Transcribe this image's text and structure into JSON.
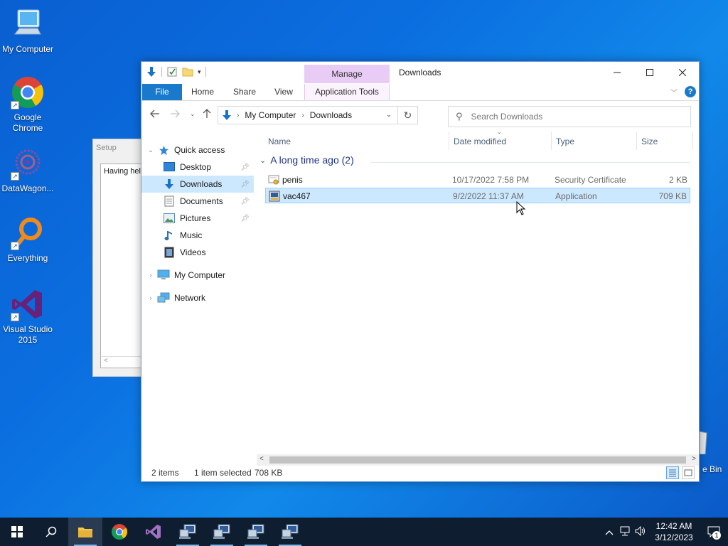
{
  "desktop": {
    "icons": [
      {
        "label": "My Computer"
      },
      {
        "label": "Google Chrome"
      },
      {
        "label": "DataWagon..."
      },
      {
        "label": "Everything"
      },
      {
        "label": "Visual Studio 2015"
      }
    ],
    "recycle_bin_partial": "e Bin"
  },
  "setup_window": {
    "title": "Setup",
    "text": "Having help"
  },
  "explorer": {
    "title": "Downloads",
    "context_tab": "Manage",
    "ribbon_tabs": {
      "file": "File",
      "home": "Home",
      "share": "Share",
      "view": "View",
      "app_tools": "Application Tools"
    },
    "address": {
      "crumbs": [
        "My Computer",
        "Downloads"
      ]
    },
    "search": {
      "placeholder": "Search Downloads"
    },
    "nav": {
      "quick_access": "Quick access",
      "items": [
        {
          "label": "Desktop",
          "pinned": true
        },
        {
          "label": "Downloads",
          "pinned": true,
          "selected": true
        },
        {
          "label": "Documents",
          "pinned": true
        },
        {
          "label": "Pictures",
          "pinned": true
        },
        {
          "label": "Music",
          "pinned": false
        },
        {
          "label": "Videos",
          "pinned": false
        }
      ],
      "my_computer": "My Computer",
      "network": "Network"
    },
    "columns": {
      "name": "Name",
      "date": "Date modified",
      "type": "Type",
      "size": "Size"
    },
    "group": {
      "label": "A long time ago (2)"
    },
    "files": [
      {
        "name": "penis",
        "date": "10/17/2022 7:58 PM",
        "type": "Security Certificate",
        "size": "2 KB",
        "selected": false
      },
      {
        "name": "vac467",
        "date": "9/2/2022 11:37 AM",
        "type": "Application",
        "size": "709 KB",
        "selected": true
      }
    ],
    "status": {
      "items": "2 items",
      "selected": "1 item selected",
      "size": "708 KB"
    }
  },
  "taskbar": {
    "time": "12:42 AM",
    "date": "3/12/2023",
    "notifications": "1"
  },
  "colors": {
    "accent": "#1979ca",
    "selection": "#cce8ff",
    "manage_tab": "#e9ccf5",
    "taskbar": "#0f1d30"
  }
}
